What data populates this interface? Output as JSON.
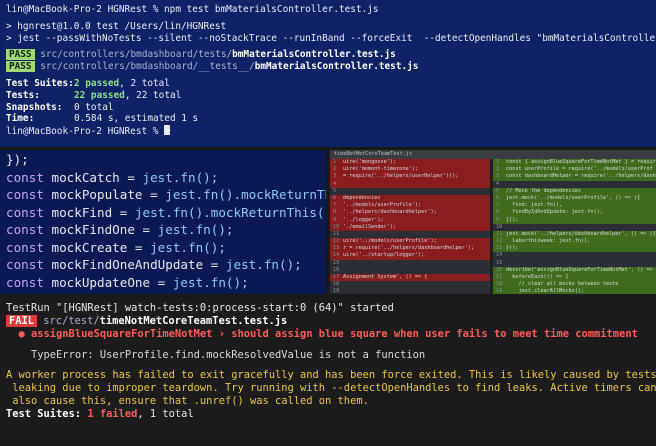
{
  "top_terminal": {
    "prompt_line": "lin@MacBook-Pro-2 HGNRest % npm test bmMaterialsController.test.js",
    "script_header": "> hgnrest@1.0.0 test /Users/lin/HGNRest",
    "script_command": "> jest --passWithNoTests --silent --noStackTrace --runInBand --forceExit  --detectOpenHandles \"bmMaterialsController.test.js\"",
    "results": [
      {
        "badge": "PASS",
        "dir": "src/controllers/bmdashboard/tests/",
        "file": "bmMaterialsController.test.js"
      },
      {
        "badge": "PASS",
        "dir": "src/controllers/bmdashboard/__tests__/",
        "file": "bmMaterialsController.test.js"
      }
    ],
    "summary": {
      "suites_label": "Test Suites:",
      "suites_value": "2 passed",
      "suites_rest": ", 2 total",
      "tests_label": "Tests:",
      "tests_value": "22 passed",
      "tests_rest": ", 22 total",
      "snapshots_label": "Snapshots:",
      "snapshots_value": "0 total",
      "time_label": "Time:",
      "time_value": "0.584 s, estimated 1 s"
    },
    "final_prompt": "lin@MacBook-Pro-2 HGNRest % "
  },
  "code_editor": {
    "first_line": "});",
    "mocks": [
      {
        "kw": "const",
        "name": "mockCatch",
        "rhs": "jest.fn();"
      },
      {
        "kw": "const",
        "name": "mockPopulate",
        "rhs": "jest.fn().mockReturnThis("
      },
      {
        "kw": "const",
        "name": "mockFind",
        "rhs": "jest.fn().mockReturnThis();"
      },
      {
        "kw": "const",
        "name": "mockFindOne",
        "rhs": "jest.fn();"
      },
      {
        "kw": "const",
        "name": "mockCreate",
        "rhs": "jest.fn();"
      },
      {
        "kw": "const",
        "name": "mockFindOneAndUpdate",
        "rhs": "jest.fn();"
      },
      {
        "kw": "const",
        "name": "mockUpdateOne",
        "rhs": "jest.fn();"
      }
    ]
  },
  "diff_view": {
    "tab_title": "timeNotMetCoreTeamTest.js",
    "left": [
      {
        "t": "del",
        "ln": "1",
        "text": "uire('mongoose');"
      },
      {
        "t": "del",
        "ln": "2",
        "text": "uire('moment-timezone');"
      },
      {
        "t": "del",
        "ln": "3",
        "text": "= require('../helpers/userHelper')();"
      },
      {
        "t": "del",
        "ln": "4",
        "text": ""
      },
      {
        "t": "ctx",
        "ln": "5",
        "text": ""
      },
      {
        "t": "del",
        "ln": "6",
        "text": "dependencies"
      },
      {
        "t": "del",
        "ln": "7",
        "text": "'../models/userProfile');"
      },
      {
        "t": "del",
        "ln": "8",
        "text": "'../helpers/dashboardhelper');"
      },
      {
        "t": "del",
        "ln": "9",
        "text": "'../logger');"
      },
      {
        "t": "del",
        "ln": "10",
        "text": "'./emailSender');"
      },
      {
        "t": "ctx",
        "ln": "11",
        "text": ""
      },
      {
        "t": "del",
        "ln": "12",
        "text": "uire('../models/userProfile');"
      },
      {
        "t": "del",
        "ln": "13",
        "text": "r = require('../helpers/dashboardhelper');"
      },
      {
        "t": "del",
        "ln": "14",
        "text": "uire('../startup/logger');"
      },
      {
        "t": "ctx",
        "ln": "15",
        "text": ""
      },
      {
        "t": "ctx",
        "ln": "16",
        "text": ""
      },
      {
        "t": "del",
        "ln": "17",
        "text": "Assignment System', () => {"
      },
      {
        "t": "ctx",
        "ln": "18",
        "text": ""
      },
      {
        "t": "ctx",
        "ln": "19",
        "text": ""
      }
    ],
    "right": [
      {
        "t": "add",
        "ln": "1",
        "text": "const { assignBlueSquareForTimeNotMet } = require"
      },
      {
        "t": "add",
        "ln": "2",
        "text": "const userProfile = require('../models/userProf"
      },
      {
        "t": "add",
        "ln": "3",
        "text": "const dashboardHelper = require('../helpers/dash"
      },
      {
        "t": "ctx",
        "ln": "4",
        "text": ""
      },
      {
        "t": "add",
        "ln": "5",
        "text": "// Mock the dependencies"
      },
      {
        "t": "add",
        "ln": "6",
        "text": "jest.mock('../models/userProfile', () => ({"
      },
      {
        "t": "add",
        "ln": "7",
        "text": "  find: jest.fn(),"
      },
      {
        "t": "add",
        "ln": "8",
        "text": "  findByIdAndUpdate: jest.fn(),"
      },
      {
        "t": "add",
        "ln": "9",
        "text": "}));"
      },
      {
        "t": "ctx",
        "ln": "10",
        "text": ""
      },
      {
        "t": "add",
        "ln": "11",
        "text": "jest.mock('../helpers/dashboardhelper', () => ({"
      },
      {
        "t": "add",
        "ln": "12",
        "text": "  laborthisweek: jest.fn(),"
      },
      {
        "t": "add",
        "ln": "13",
        "text": "}));"
      },
      {
        "t": "ctx",
        "ln": "14",
        "text": ""
      },
      {
        "t": "ctx",
        "ln": "15",
        "text": ""
      },
      {
        "t": "add",
        "ln": "16",
        "text": "describe('assignBlueSquareForTimeNotMet', () => {"
      },
      {
        "t": "add",
        "ln": "17",
        "text": "  beforeEach(() => {"
      },
      {
        "t": "add",
        "ln": "18",
        "text": "    // clear all mocks between tests"
      },
      {
        "t": "add",
        "ln": "19",
        "text": "    jest.clearAllMocks();"
      }
    ]
  },
  "bottom_terminal": {
    "run_line": "TestRun \"[HGNRest] watch-tests:0:process-start:0 (64)\" started",
    "fail_badge": "FAIL",
    "fail_dir": "src/test/",
    "fail_file": "timeNotMetCoreTeamTest.test.js",
    "bullet_line": "● assignBlueSquareForTimeNotMet › should assign blue square when user fails to meet time commitment",
    "error_line": "TypeError: UserProfile.find.mockResolvedValue is not a function",
    "warn_1": "A worker process has failed to exit gracefully and has been force exited. This is likely caused by tests",
    "warn_2": " leaking due to improper teardown. Try running with --detectOpenHandles to find leaks. Active timers can",
    "warn_3": " also cause this, ensure that .unref() was called on them.",
    "suites_label": "Test Suites:",
    "suites_failed": "1 failed",
    "suites_rest": ", 1 total"
  }
}
